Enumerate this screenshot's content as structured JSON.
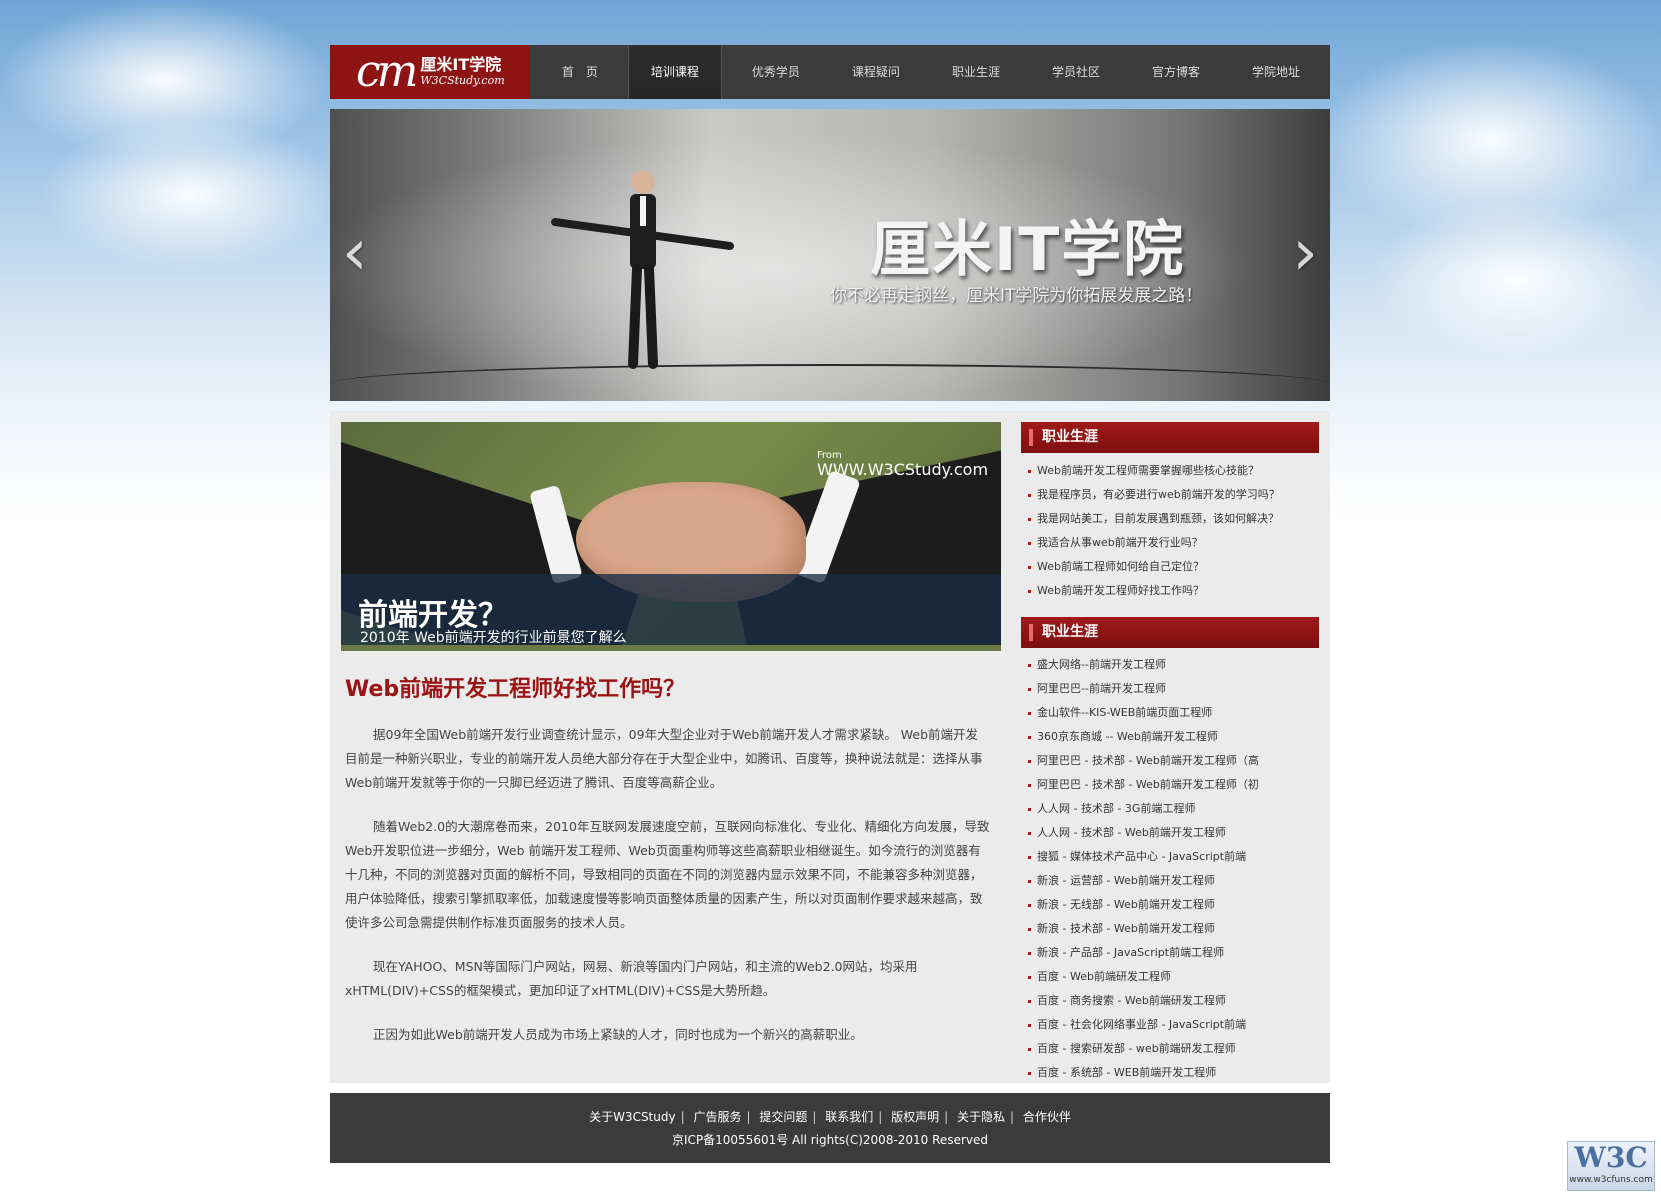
{
  "logo": {
    "mark": "cm",
    "name": "厘米IT学院",
    "site": "W3CStudy.com"
  },
  "nav": [
    {
      "label": "首　页"
    },
    {
      "label": "培训课程"
    },
    {
      "label": "优秀学员"
    },
    {
      "label": "课程疑问"
    },
    {
      "label": "职业生涯"
    },
    {
      "label": "学员社区"
    },
    {
      "label": "官方博客"
    },
    {
      "label": "学院地址"
    }
  ],
  "banner": {
    "title": "厘米IT学院",
    "subtitle": "你不必再走钢丝，厘米IT学院为你拓展发展之路！",
    "prev_icon": "‹",
    "next_icon": "›"
  },
  "feature": {
    "from": "From",
    "site": "WWW.W3CStudy.com",
    "title": "前端开发？",
    "subtitle": "2010年 Web前端开发的行业前景您了解么"
  },
  "article": {
    "title": "Web前端开发工程师好找工作吗？",
    "paragraphs": [
      "据09年全国Web前端开发行业调查统计显示，09年大型企业对于Web前端开发人才需求紧缺。 Web前端开发目前是一种新兴职业，专业的前端开发人员绝大部分存在于大型企业中，如腾讯、百度等，换种说法就是：选择从事Web前端开发就等于你的一只脚已经迈进了腾讯、百度等高薪企业。",
      "随着Web2.0的大潮席卷而来，2010年互联网发展速度空前，互联网向标准化、专业化、精细化方向发展，导致Web开发职位进一步细分，Web 前端开发工程师、Web页面重构师等这些高薪职业相继诞生。如今流行的浏览器有十几种，不同的浏览器对页面的解析不同，导致相同的页面在不同的浏览器内显示效果不同，不能兼容多种浏览器，用户体验降低，搜索引擎抓取率低，加载速度慢等影响页面整体质量的因素产生，所以对页面制作要求越来越高，致使许多公司急需提供制作标准页面服务的技术人员。",
      "现在YAHOO、MSN等国际门户网站，网易、新浪等国内门户网站，和主流的Web2.0网站，均采用xHTML(DIV)+CSS的框架模式，更加印证了xHTML(DIV)+CSS是大势所趋。",
      "正因为如此Web前端开发人员成为市场上紧缺的人才，同时也成为一个新兴的高薪职业。"
    ]
  },
  "sidebar": {
    "section1": {
      "title": "职业生涯",
      "items": [
        "Web前端开发工程师需要掌握哪些核心技能？",
        "我是程序员，有必要进行web前端开发的学习吗？",
        "我是网站美工，目前发展遇到瓶颈，该如何解决？",
        "我适合从事web前端开发行业吗？",
        "Web前端工程师如何给自己定位？",
        "Web前端开发工程师好找工作吗？"
      ]
    },
    "section2": {
      "title": "职业生涯",
      "items": [
        "盛大网络--前端开发工程师",
        "阿里巴巴--前端开发工程师",
        "金山软件--KIS-WEB前端页面工程师",
        "360京东商城 -- Web前端开发工程师",
        "阿里巴巴 - 技术部 - Web前端开发工程师（高",
        "阿里巴巴 - 技术部 - Web前端开发工程师（初",
        "人人网 - 技术部 - 3G前端工程师",
        "人人网 - 技术部 - Web前端开发工程师",
        "搜狐 - 媒体技术产品中心 - JavaScript前端",
        "新浪 - 运营部 - Web前端开发工程师",
        "新浪 - 无线部 - Web前端开发工程师",
        "新浪 - 技术部 - Web前端开发工程师",
        "新浪 - 产品部 - JavaScript前端工程师",
        "百度 - Web前端研发工程师",
        "百度 - 商务搜索 - Web前端研发工程师",
        "百度 - 社会化网络事业部 - JavaScript前端",
        "百度 - 搜索研发部 - web前端研发工程师",
        "百度 - 系统部 - WEB前端开发工程师"
      ]
    }
  },
  "footer": {
    "links": [
      "关于W3CStudy",
      "广告服务",
      "提交问题",
      "联系我们",
      "版权声明",
      "关于隐私",
      "合作伙伴"
    ],
    "separator": "|",
    "icp": "京ICP备10055601号  All rights(C)2008-2010 Reserved"
  },
  "badge": {
    "logo": "W3C",
    "url": "www.w3cfuns.com"
  },
  "colors": {
    "brand_red": "#8e1414",
    "title_red": "#9b1414",
    "bar_dark": "#3b3b3b",
    "content_bg": "#ebebeb"
  }
}
